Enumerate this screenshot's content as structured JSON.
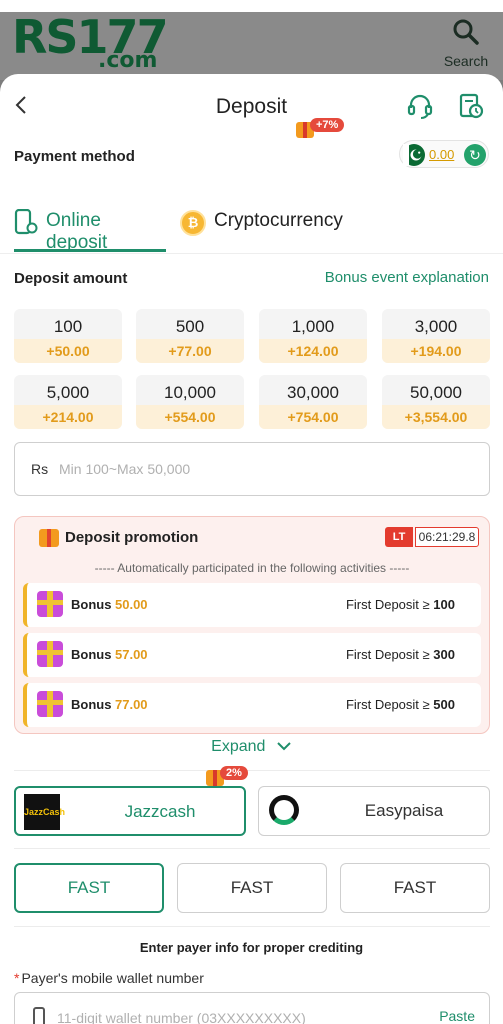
{
  "header": {
    "logo_main": "RS177",
    "logo_tld": ".com",
    "search_label": "Search"
  },
  "nav": {
    "title": "Deposit",
    "back_glyph": "<"
  },
  "payment": {
    "label": "Payment method",
    "balance": "0.00"
  },
  "tabs": [
    {
      "label": "Online deposit",
      "active": true
    },
    {
      "label": "Cryptocurrency",
      "active": false,
      "badge": "+7%"
    }
  ],
  "deposit": {
    "label": "Deposit amount",
    "bonus_link": "Bonus event explanation",
    "amounts": [
      {
        "value": "100",
        "bonus": "+50.00"
      },
      {
        "value": "500",
        "bonus": "+77.00"
      },
      {
        "value": "1,000",
        "bonus": "+124.00"
      },
      {
        "value": "3,000",
        "bonus": "+194.00"
      },
      {
        "value": "5,000",
        "bonus": "+214.00"
      },
      {
        "value": "10,000",
        "bonus": "+554.00"
      },
      {
        "value": "30,000",
        "bonus": "+754.00"
      },
      {
        "value": "50,000",
        "bonus": "+3,554.00"
      }
    ],
    "currency": "Rs",
    "placeholder": "Min 100~Max 50,000"
  },
  "promotion": {
    "title": "Deposit promotion",
    "timer_tag": "LT",
    "timer": "06:21:29.8",
    "subtitle": "----- Automatically participated in the following activities -----",
    "rules": [
      {
        "bonus_label": "Bonus",
        "bonus": "50.00",
        "condition": "First Deposit ≥",
        "threshold": "100"
      },
      {
        "bonus_label": "Bonus",
        "bonus": "57.00",
        "condition": "First Deposit ≥",
        "threshold": "300"
      },
      {
        "bonus_label": "Bonus",
        "bonus": "77.00",
        "condition": "First Deposit ≥",
        "threshold": "500"
      }
    ],
    "expand_label": "Expand"
  },
  "channels": [
    {
      "name": "Jazzcash",
      "logo_text": "JazzCash",
      "active": true,
      "badge": "2%"
    },
    {
      "name": "Easypaisa",
      "active": false
    }
  ],
  "speeds": [
    {
      "label": "FAST",
      "active": true
    },
    {
      "label": "FAST",
      "active": false
    },
    {
      "label": "FAST",
      "active": false
    }
  ],
  "payer": {
    "title": "Enter payer info for proper crediting",
    "wallet_label": "Payer's mobile wallet number",
    "required_mark": "*",
    "wallet_placeholder": "11-digit wallet number (03XXXXXXXXX)",
    "paste_label": "Paste"
  },
  "colors": {
    "accent": "#1f8e6b",
    "bonus": "#e29b1b",
    "danger": "#e33b2e",
    "logo": "#0f5a33"
  },
  "icons": {
    "back": "chevron-left-icon",
    "support": "headset-icon",
    "history": "clock-document-icon",
    "search": "search-icon"
  }
}
